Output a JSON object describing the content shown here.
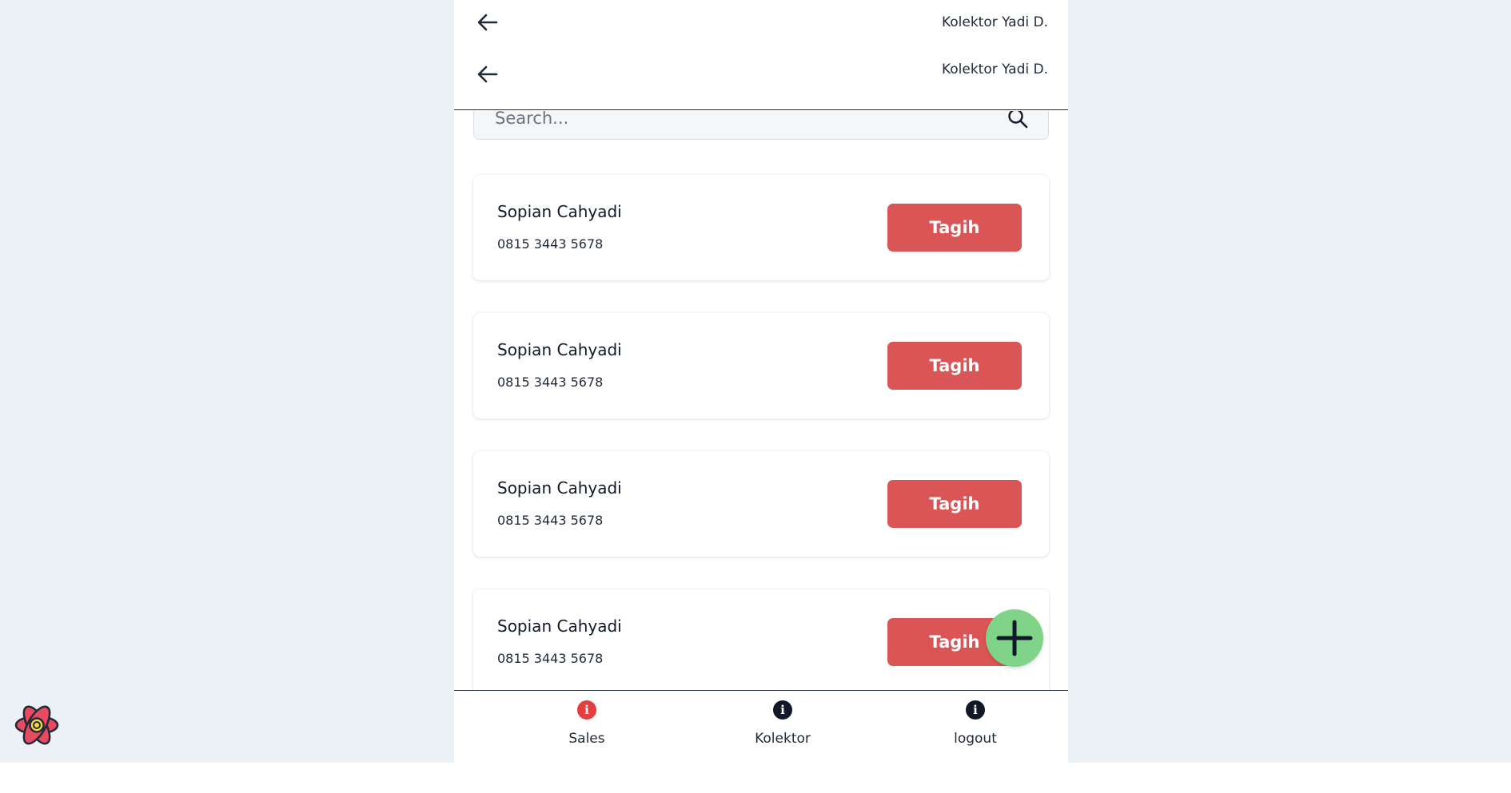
{
  "header": {
    "rows": [
      {
        "user_label": "Kolektor Yadi D."
      },
      {
        "user_label": "Kolektor Yadi D."
      }
    ]
  },
  "search": {
    "placeholder": "Search..."
  },
  "customers": [
    {
      "name": "Sopian Cahyadi",
      "phone": "0815 3443 5678",
      "action_label": "Tagih"
    },
    {
      "name": "Sopian Cahyadi",
      "phone": "0815 3443 5678",
      "action_label": "Tagih"
    },
    {
      "name": "Sopian Cahyadi",
      "phone": "0815 3443 5678",
      "action_label": "Tagih"
    },
    {
      "name": "Sopian Cahyadi",
      "phone": "0815 3443 5678",
      "action_label": "Tagih"
    }
  ],
  "fab": {
    "icon": "plus-icon",
    "color": "#7fd48a"
  },
  "bottom_nav": {
    "items": [
      {
        "label": "Sales",
        "icon": "info-icon",
        "active": true,
        "icon_color": "#e53e3e"
      },
      {
        "label": "Kolektor",
        "icon": "info-icon",
        "active": false,
        "icon_color": "#111827"
      },
      {
        "label": "logout",
        "icon": "info-icon",
        "active": false,
        "icon_color": "#111827"
      }
    ]
  },
  "colors": {
    "accent": "#d95556",
    "fab": "#7fd48a",
    "backdrop": "#ecf1f6",
    "active_nav": "#e53e3e"
  },
  "devtools": {
    "icon": "react-logo-icon"
  }
}
